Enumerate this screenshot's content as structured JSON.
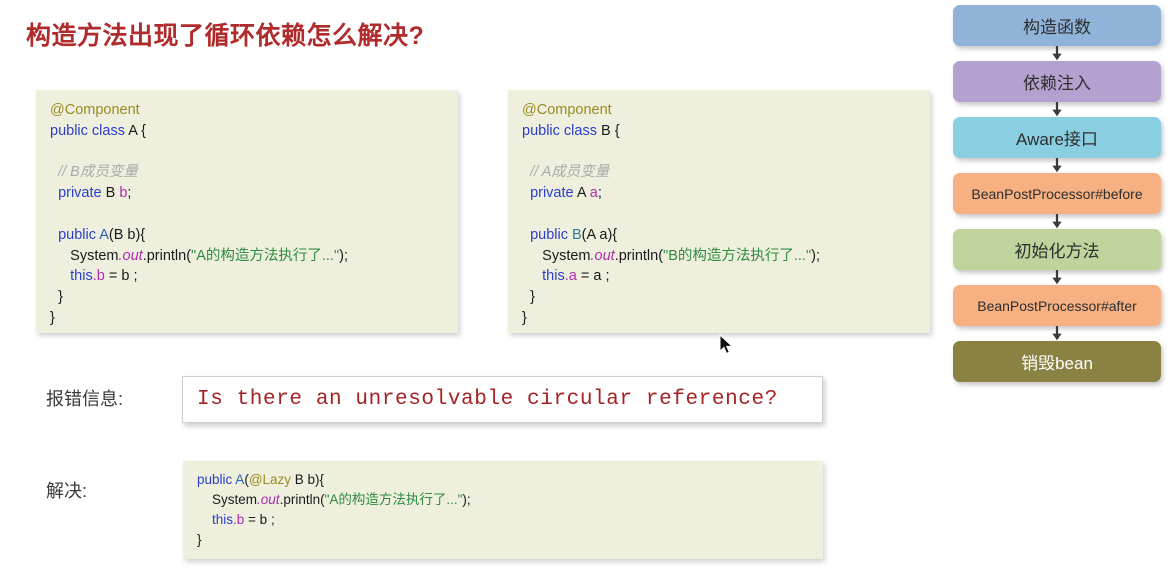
{
  "title": "构造方法出现了循环依赖怎么解决?",
  "title_color": "#b02b2b",
  "code_a": {
    "annotation": "@Component",
    "kw_public": "public",
    "kw_class": "class",
    "class_name": "A",
    "brace_open": "{",
    "comment": "// B成员变量",
    "kw_private": "private",
    "field_type": "B",
    "field_name": "b",
    "semi": ";",
    "ctor_name": "A",
    "ctor_params": "(B b){",
    "print_system": "System",
    "print_out": ".out",
    "print_method": ".println(",
    "print_string": "\"A的构造方法执行了...\"",
    "print_tail": ");",
    "assign_this": "this",
    "assign_field": ".b",
    "assign_rest": " = b ;",
    "brace_close_inner": "}",
    "brace_close_outer": "}"
  },
  "code_b": {
    "annotation": "@Component",
    "kw_public": "public",
    "kw_class": "class",
    "class_name": "B",
    "brace_open": "{",
    "comment": "// A成员变量",
    "kw_private": "private",
    "field_type": "A",
    "field_name": "a",
    "semi": ";",
    "ctor_name": "B",
    "ctor_params": "(A a){",
    "print_system": "System",
    "print_out": ".out",
    "print_method": ".println(",
    "print_string": "\"B的构造方法执行了...\"",
    "print_tail": ");",
    "assign_this": "this",
    "assign_field": ".a",
    "assign_rest": " = a ;",
    "brace_close_inner": "}",
    "brace_close_outer": "}"
  },
  "error_row": {
    "label": "报错信息:",
    "message": "Is there an unresolvable circular reference?",
    "message_color": "#a32323"
  },
  "fix_row": {
    "label": "解决:",
    "code": {
      "kw_public": "public",
      "ctor_name": "A",
      "paren_open": "(",
      "annotation": "@Lazy",
      "param": " B b){",
      "print_system": "System",
      "print_out": ".out",
      "print_method": ".println(",
      "print_string": "\"A的构造方法执行了...\"",
      "print_tail": ");",
      "assign_this": "this",
      "assign_field": ".b",
      "assign_rest": " = b ;",
      "brace_close": "}"
    }
  },
  "flow": {
    "nodes": [
      {
        "label": "构造函数",
        "color": "#8fb3d9",
        "script": "cjk",
        "text_color": "dark"
      },
      {
        "label": "依赖注入",
        "color": "#b4a1d0",
        "script": "cjk",
        "text_color": "dark"
      },
      {
        "label": "Aware接口",
        "color": "#89cee1",
        "script": "cjk",
        "text_color": "dark"
      },
      {
        "label": "BeanPostProcessor#before",
        "color": "#f6b081",
        "script": "lat",
        "text_color": "dark"
      },
      {
        "label": "初始化方法",
        "color": "#bed49c",
        "script": "cjk",
        "text_color": "dark"
      },
      {
        "label": "BeanPostProcessor#after",
        "color": "#f6b081",
        "script": "lat",
        "text_color": "dark"
      },
      {
        "label": "销毁bean",
        "color": "#8a8243",
        "script": "cjk",
        "text_color": "light"
      }
    ],
    "arrow_color": "#3a3a3a"
  }
}
